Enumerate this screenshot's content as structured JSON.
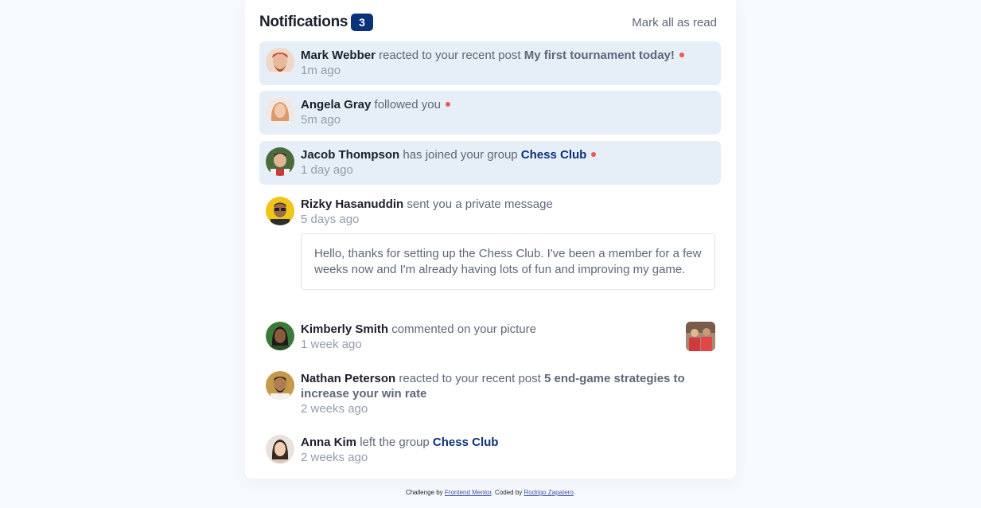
{
  "header": {
    "title": "Notifications",
    "count": "3",
    "mark_all": "Mark all as read"
  },
  "colors": {
    "accent": "#0a327b",
    "unread_bg": "#e6eef8",
    "dot": "#f65552"
  },
  "notifications": [
    {
      "name": "Mark Webber",
      "action": "reacted to your recent post",
      "target": "My first tournament today!",
      "time": "1m ago",
      "unread": true
    },
    {
      "name": "Angela Gray",
      "action": "followed you",
      "time": "5m ago",
      "unread": true
    },
    {
      "name": "Jacob Thompson",
      "action": "has joined your group",
      "target": "Chess Club",
      "time": "1 day ago",
      "unread": true
    },
    {
      "name": "Rizky Hasanuddin",
      "action": "sent you a private message",
      "time": "5 days ago",
      "message": "Hello, thanks for setting up the Chess Club. I've been a member for a few weeks now and I'm already having lots of fun and improving my game."
    },
    {
      "name": "Kimberly Smith",
      "action": "commented on your picture",
      "time": "1 week ago"
    },
    {
      "name": "Nathan Peterson",
      "action": "reacted to your recent post",
      "target": "5 end-game strategies to increase your win rate",
      "time": "2 weeks ago"
    },
    {
      "name": "Anna Kim",
      "action": "left the group",
      "target": "Chess Club",
      "time": "2 weeks ago"
    }
  ],
  "footer": {
    "prefix": "Challenge by",
    "link1": "Frontend Mentor",
    "middle": ". Coded by",
    "link2": "Rodrigo Zapatero",
    "suffix": "."
  }
}
